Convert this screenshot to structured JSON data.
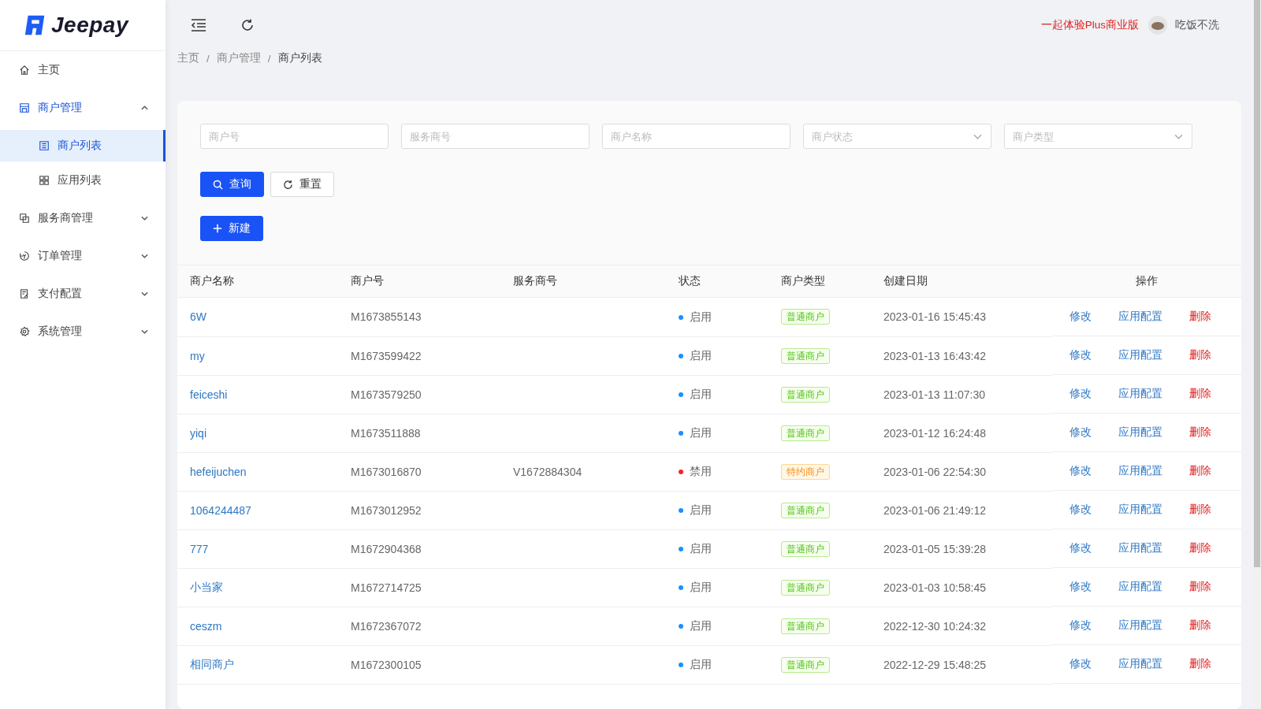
{
  "logo": {
    "text": "Jeepay"
  },
  "sidebar": {
    "items": [
      {
        "label": "主页",
        "selected": false
      },
      {
        "label": "商户管理",
        "expanded": true,
        "selected": true,
        "children": [
          {
            "label": "商户列表",
            "selected": true
          },
          {
            "label": "应用列表",
            "selected": false
          }
        ]
      },
      {
        "label": "服务商管理",
        "expanded": false,
        "selected": false
      },
      {
        "label": "订单管理",
        "expanded": false,
        "selected": false
      },
      {
        "label": "支付配置",
        "expanded": false,
        "selected": false
      },
      {
        "label": "系统管理",
        "expanded": false,
        "selected": false
      }
    ]
  },
  "header": {
    "promo": "一起体验Plus商业版",
    "user": "吃饭不洗"
  },
  "breadcrumb": {
    "separator": "/",
    "items": [
      "主页",
      "商户管理",
      "商户列表"
    ]
  },
  "filters": [
    {
      "placeholder": "商户号",
      "kind": "input"
    },
    {
      "placeholder": "服务商号",
      "kind": "input"
    },
    {
      "placeholder": "商户名称",
      "kind": "input"
    },
    {
      "placeholder": "商户状态",
      "kind": "select"
    },
    {
      "placeholder": "商户类型",
      "kind": "select"
    }
  ],
  "buttons": {
    "search": "查询",
    "reset": "重置",
    "create": "新建"
  },
  "table": {
    "columns": [
      "商户名称",
      "商户号",
      "服务商号",
      "状态",
      "商户类型",
      "创建日期",
      "操作"
    ],
    "rows": [
      {
        "name": "6W",
        "mch_no": "M1673855143",
        "enabled": true,
        "status": "启用",
        "type": "普通商户",
        "kind": "normal",
        "created": "2023-01-16 15:45:43",
        "actions": [
          "修改",
          "应用配置",
          "删除"
        ]
      },
      {
        "name": "my",
        "mch_no": "M1673599422",
        "enabled": true,
        "status": "启用",
        "type": "普通商户",
        "kind": "normal",
        "created": "2023-01-13 16:43:42",
        "actions": [
          "修改",
          "应用配置",
          "删除"
        ]
      },
      {
        "name": "feiceshi",
        "mch_no": "M1673579250",
        "enabled": true,
        "status": "启用",
        "type": "普通商户",
        "kind": "normal",
        "created": "2023-01-13 11:07:30",
        "actions": [
          "修改",
          "应用配置",
          "删除"
        ]
      },
      {
        "name": "yiqi",
        "mch_no": "M1673511888",
        "enabled": true,
        "status": "启用",
        "type": "普通商户",
        "kind": "normal",
        "created": "2023-01-12 16:24:48",
        "actions": [
          "修改",
          "应用配置",
          "删除"
        ]
      },
      {
        "name": "hefeijuchen",
        "mch_no": "M1673016870",
        "isv_no": "V1672884304",
        "enabled": false,
        "status": "禁用",
        "type": "特约商户",
        "kind": "special",
        "created": "2023-01-06 22:54:30",
        "actions": [
          "修改",
          "应用配置",
          "删除"
        ]
      },
      {
        "name": "1064244487",
        "mch_no": "M1673012952",
        "enabled": true,
        "status": "启用",
        "type": "普通商户",
        "kind": "normal",
        "created": "2023-01-06 21:49:12",
        "actions": [
          "修改",
          "应用配置",
          "删除"
        ]
      },
      {
        "name": "777",
        "mch_no": "M1672904368",
        "enabled": true,
        "status": "启用",
        "type": "普通商户",
        "kind": "normal",
        "created": "2023-01-05 15:39:28",
        "actions": [
          "修改",
          "应用配置",
          "删除"
        ]
      },
      {
        "name": "小当家",
        "mch_no": "M1672714725",
        "enabled": true,
        "status": "启用",
        "type": "普通商户",
        "kind": "normal",
        "created": "2023-01-03 10:58:45",
        "actions": [
          "修改",
          "应用配置",
          "删除"
        ]
      },
      {
        "name": "ceszm",
        "mch_no": "M1672367072",
        "enabled": true,
        "status": "启用",
        "type": "普通商户",
        "kind": "normal",
        "created": "2022-12-30 10:24:32",
        "actions": [
          "修改",
          "应用配置",
          "删除"
        ]
      },
      {
        "name": "相同商户",
        "mch_no": "M1672300105",
        "enabled": true,
        "status": "启用",
        "type": "普通商户",
        "kind": "normal",
        "created": "2022-12-29 15:48:25",
        "actions": [
          "修改",
          "应用配置",
          "删除"
        ]
      }
    ]
  }
}
